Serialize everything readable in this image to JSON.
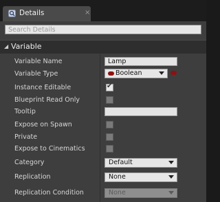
{
  "tab": {
    "title": "Details",
    "icon": "details-magnifier-icon",
    "close": "×"
  },
  "search": {
    "placeholder": "Search Details",
    "value": ""
  },
  "section": {
    "title": "Variable",
    "collapsed": false
  },
  "properties": {
    "variable_name": {
      "label": "Variable Name",
      "value": "Lamp"
    },
    "variable_type": {
      "label": "Variable Type",
      "value": "Boolean",
      "pin_color": "#8d1111"
    },
    "instance_editable": {
      "label": "Instance Editable",
      "checked": true
    },
    "blueprint_read_only": {
      "label": "Blueprint Read Only",
      "checked": false
    },
    "tooltip": {
      "label": "Tooltip",
      "value": ""
    },
    "expose_on_spawn": {
      "label": "Expose on Spawn",
      "checked": false
    },
    "private": {
      "label": "Private",
      "checked": false
    },
    "expose_to_cinematics": {
      "label": "Expose to Cinematics",
      "checked": false
    },
    "category": {
      "label": "Category",
      "value": "Default"
    },
    "replication": {
      "label": "Replication",
      "value": "None"
    },
    "replication_condition": {
      "label": "Replication Condition",
      "value": "None",
      "enabled": false
    }
  },
  "check_glyph": "✔"
}
